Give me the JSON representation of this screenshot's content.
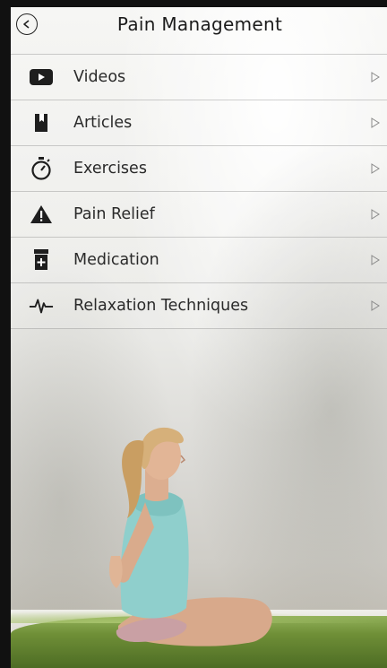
{
  "header": {
    "title": "Pain Management",
    "back_icon": "back-circle-icon"
  },
  "menu": {
    "items": [
      {
        "label": "Videos",
        "icon": "video-play-icon"
      },
      {
        "label": "Articles",
        "icon": "bookmark-book-icon"
      },
      {
        "label": "Exercises",
        "icon": "stopwatch-icon"
      },
      {
        "label": "Pain Relief",
        "icon": "warning-triangle-icon"
      },
      {
        "label": "Medication",
        "icon": "pill-bottle-icon"
      },
      {
        "label": "Relaxation Techniques",
        "icon": "heartbeat-pulse-icon"
      }
    ],
    "chevron_icon": "chevron-right-icon"
  },
  "colors": {
    "icon": "#1e1e1e",
    "text": "#2a2a2a",
    "divider": "#9a9a9a",
    "grass": "#6f8f37",
    "top_color": "#5aa7a5"
  }
}
